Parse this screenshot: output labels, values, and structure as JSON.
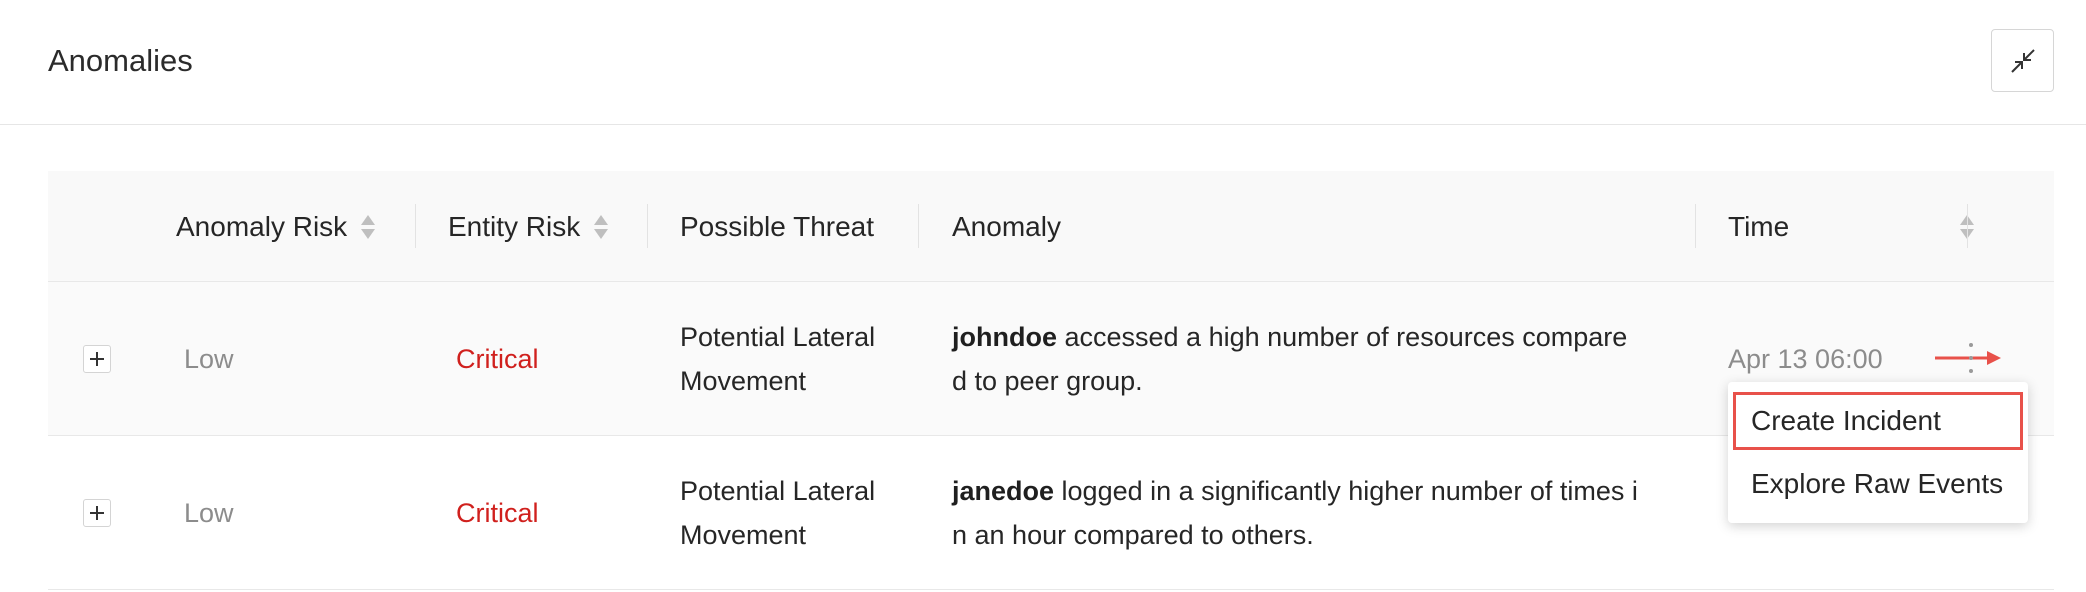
{
  "panel": {
    "title": "Anomalies"
  },
  "table": {
    "columns": [
      {
        "label": "Anomaly Risk",
        "sortable": true
      },
      {
        "label": "Entity Risk",
        "sortable": true
      },
      {
        "label": "Possible Threat",
        "sortable": false
      },
      {
        "label": "Anomaly",
        "sortable": false
      },
      {
        "label": "Time",
        "sortable": true
      }
    ],
    "rows": [
      {
        "anomaly_risk": "Low",
        "entity_risk": "Critical",
        "threat_line1": "Potential Lateral",
        "threat_line2": "Movement",
        "user": "johndoe",
        "anomaly_line1_rest": " accessed a high number of resources compare",
        "anomaly_line2": "d to peer group.",
        "time": "Apr 13 06:00"
      },
      {
        "anomaly_risk": "Low",
        "entity_risk": "Critical",
        "threat_line1": "Potential Lateral",
        "threat_line2": "Movement",
        "user": "janedoe",
        "anomaly_line1_rest": " logged in a significantly higher number of times i",
        "anomaly_line2": "n an hour compared to others.",
        "time": ""
      }
    ]
  },
  "context_menu": {
    "items": [
      {
        "label": "Create Incident"
      },
      {
        "label": "Explore Raw Events"
      }
    ]
  },
  "colors": {
    "critical": "#d0201d",
    "low": "#8c8c8c",
    "highlight": "#e8514a"
  },
  "icons": {
    "collapse": "collapse-arrows-icon",
    "expand": "plus-icon",
    "more": "kebab-menu-icon",
    "sort": "sort-arrows-icon"
  }
}
